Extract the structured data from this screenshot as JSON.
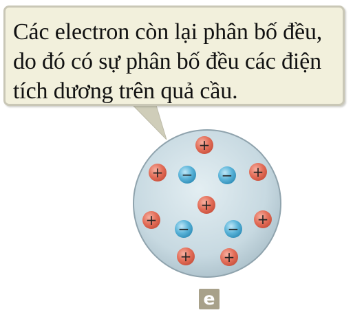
{
  "callout": {
    "lines": [
      "Các electron còn lại phân bố đều,",
      "do đó có sự phân bố đều các điện",
      "tích dương trên quả cầu."
    ]
  },
  "panel_label": "e",
  "sphere": {
    "protons": [
      {
        "symbol": "+"
      },
      {
        "symbol": "+"
      },
      {
        "symbol": "+"
      },
      {
        "symbol": "+"
      },
      {
        "symbol": "+"
      },
      {
        "symbol": "+"
      },
      {
        "symbol": "+"
      },
      {
        "symbol": "+"
      }
    ],
    "electrons": [
      {
        "symbol": "−"
      },
      {
        "symbol": "−"
      },
      {
        "symbol": "−"
      },
      {
        "symbol": "−"
      }
    ]
  },
  "colors": {
    "callout_fill": "#f2f0dc",
    "callout_border": "#c9c7b6",
    "sphere_fill": "#c9dbe3",
    "sphere_border": "#8fa3ad",
    "proton": "#e06650",
    "electron": "#4aa7cf",
    "label_badge": "#a8a18a"
  }
}
